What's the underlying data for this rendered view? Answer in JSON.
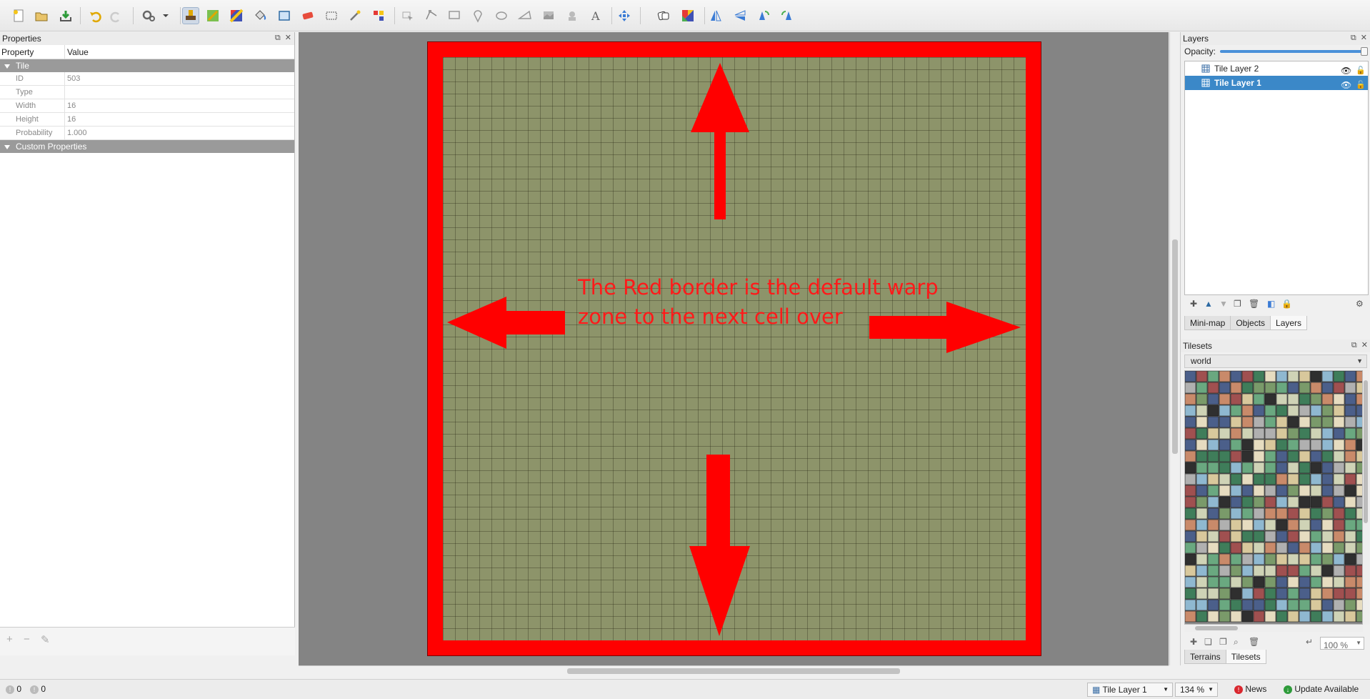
{
  "properties": {
    "title": "Properties",
    "col_property": "Property",
    "col_value": "Value",
    "group_tile": "Tile",
    "rows": [
      {
        "name": "ID",
        "value": "503"
      },
      {
        "name": "Type",
        "value": ""
      },
      {
        "name": "Width",
        "value": "16"
      },
      {
        "name": "Height",
        "value": "16"
      },
      {
        "name": "Probability",
        "value": "1.000"
      }
    ],
    "group_custom": "Custom Properties"
  },
  "canvas": {
    "annotation_line1": "The Red border is the default warp",
    "annotation_line2": "zone to the next cell over",
    "border_color": "#ff0000",
    "ground_color": "#8d946a"
  },
  "layers": {
    "title": "Layers",
    "opacity_label": "Opacity:",
    "opacity": 1.0,
    "items": [
      {
        "name": "Tile Layer 2",
        "selected": false
      },
      {
        "name": "Tile Layer 1",
        "selected": true
      }
    ],
    "tabs": [
      "Mini-map",
      "Objects",
      "Layers"
    ],
    "active_tab": "Layers"
  },
  "tilesets": {
    "title": "Tilesets",
    "selected": "world",
    "zoom": "100 %",
    "tabs": [
      "Terrains",
      "Tilesets"
    ],
    "active_tab": "Tilesets"
  },
  "status": {
    "errors": "0",
    "warnings": "0",
    "layer": "Tile Layer 1",
    "zoom": "134 %",
    "news": "News",
    "update": "Update Available",
    "news_color": "#d9272e",
    "update_color": "#2e9b3a"
  }
}
